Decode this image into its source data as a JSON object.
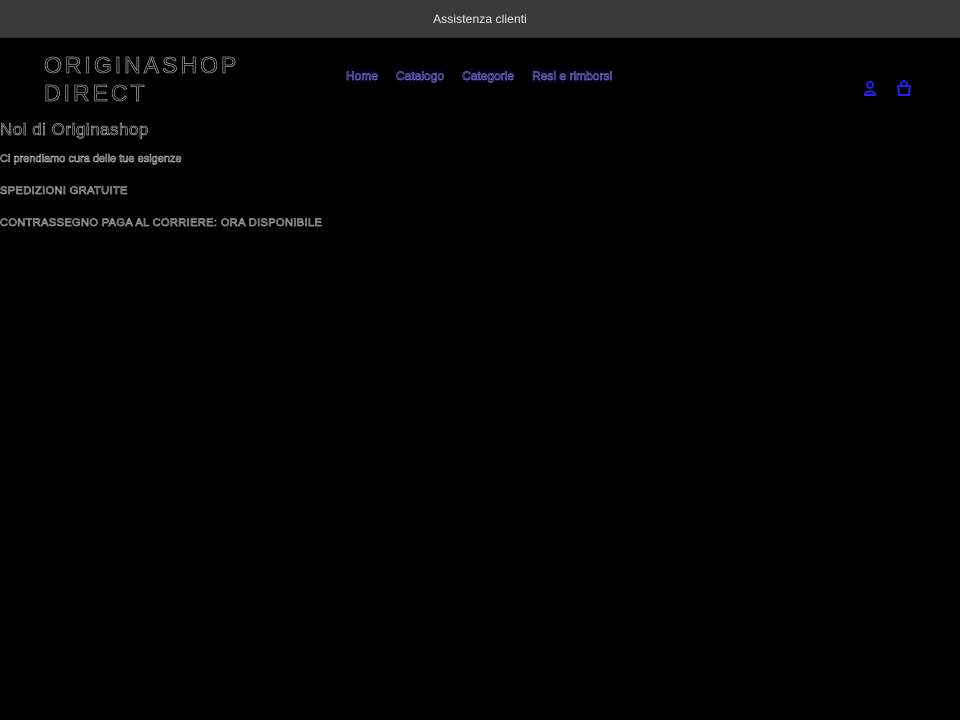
{
  "announcement": {
    "text": "Assistenza clienti"
  },
  "header": {
    "logo_line1": "ORIGINASHOP",
    "logo_line2": "DIRECT",
    "nav": [
      {
        "label": "Home"
      },
      {
        "label": "Catalogo"
      },
      {
        "label": "Categorie"
      },
      {
        "label": "Resi e rimborsi"
      }
    ],
    "icons": {
      "account": "account-icon",
      "cart": "cart-icon"
    },
    "icon_color": "#2222ee"
  },
  "main": {
    "title": "Noi di Originashop",
    "lines": [
      "Ci prendiamo cura delle tue esigenze",
      "SPEDIZIONI GRATUITE",
      "CONTRASSEGNO PAGA AL CORRIERE: ORA DISPONIBILE"
    ]
  },
  "colors": {
    "announcement_bg": "#3a3a3a",
    "page_bg": "#000000",
    "nav_link": "#8c8cff",
    "icon": "#2222ee"
  }
}
